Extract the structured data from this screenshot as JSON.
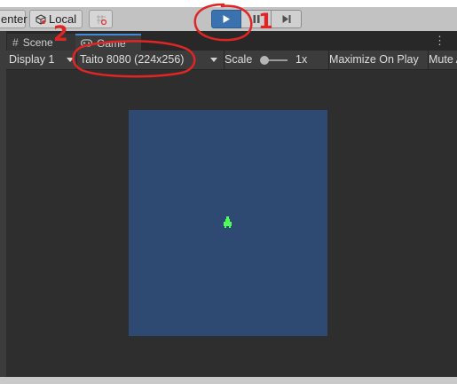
{
  "toolbar": {
    "pivot_label": "enter",
    "handle_label": "Local"
  },
  "tabs": [
    {
      "label": "Scene",
      "icon": "grid-icon"
    },
    {
      "label": "Game",
      "icon": "gamepad-icon",
      "active": true
    }
  ],
  "game_toolbar": {
    "display": "Display 1",
    "resolution": "Taito 8080 (224x256)",
    "scale_label": "Scale",
    "scale_value": "1x",
    "maximize": "Maximize On Play",
    "mute": "Mute Audio"
  },
  "annotations": {
    "step_1": "1",
    "step_2": "2"
  },
  "colors": {
    "play_accent": "#3a72b0",
    "game_canvas": "#2e4a72",
    "sprite": "#4cff5a",
    "annotation": "#e02525"
  }
}
